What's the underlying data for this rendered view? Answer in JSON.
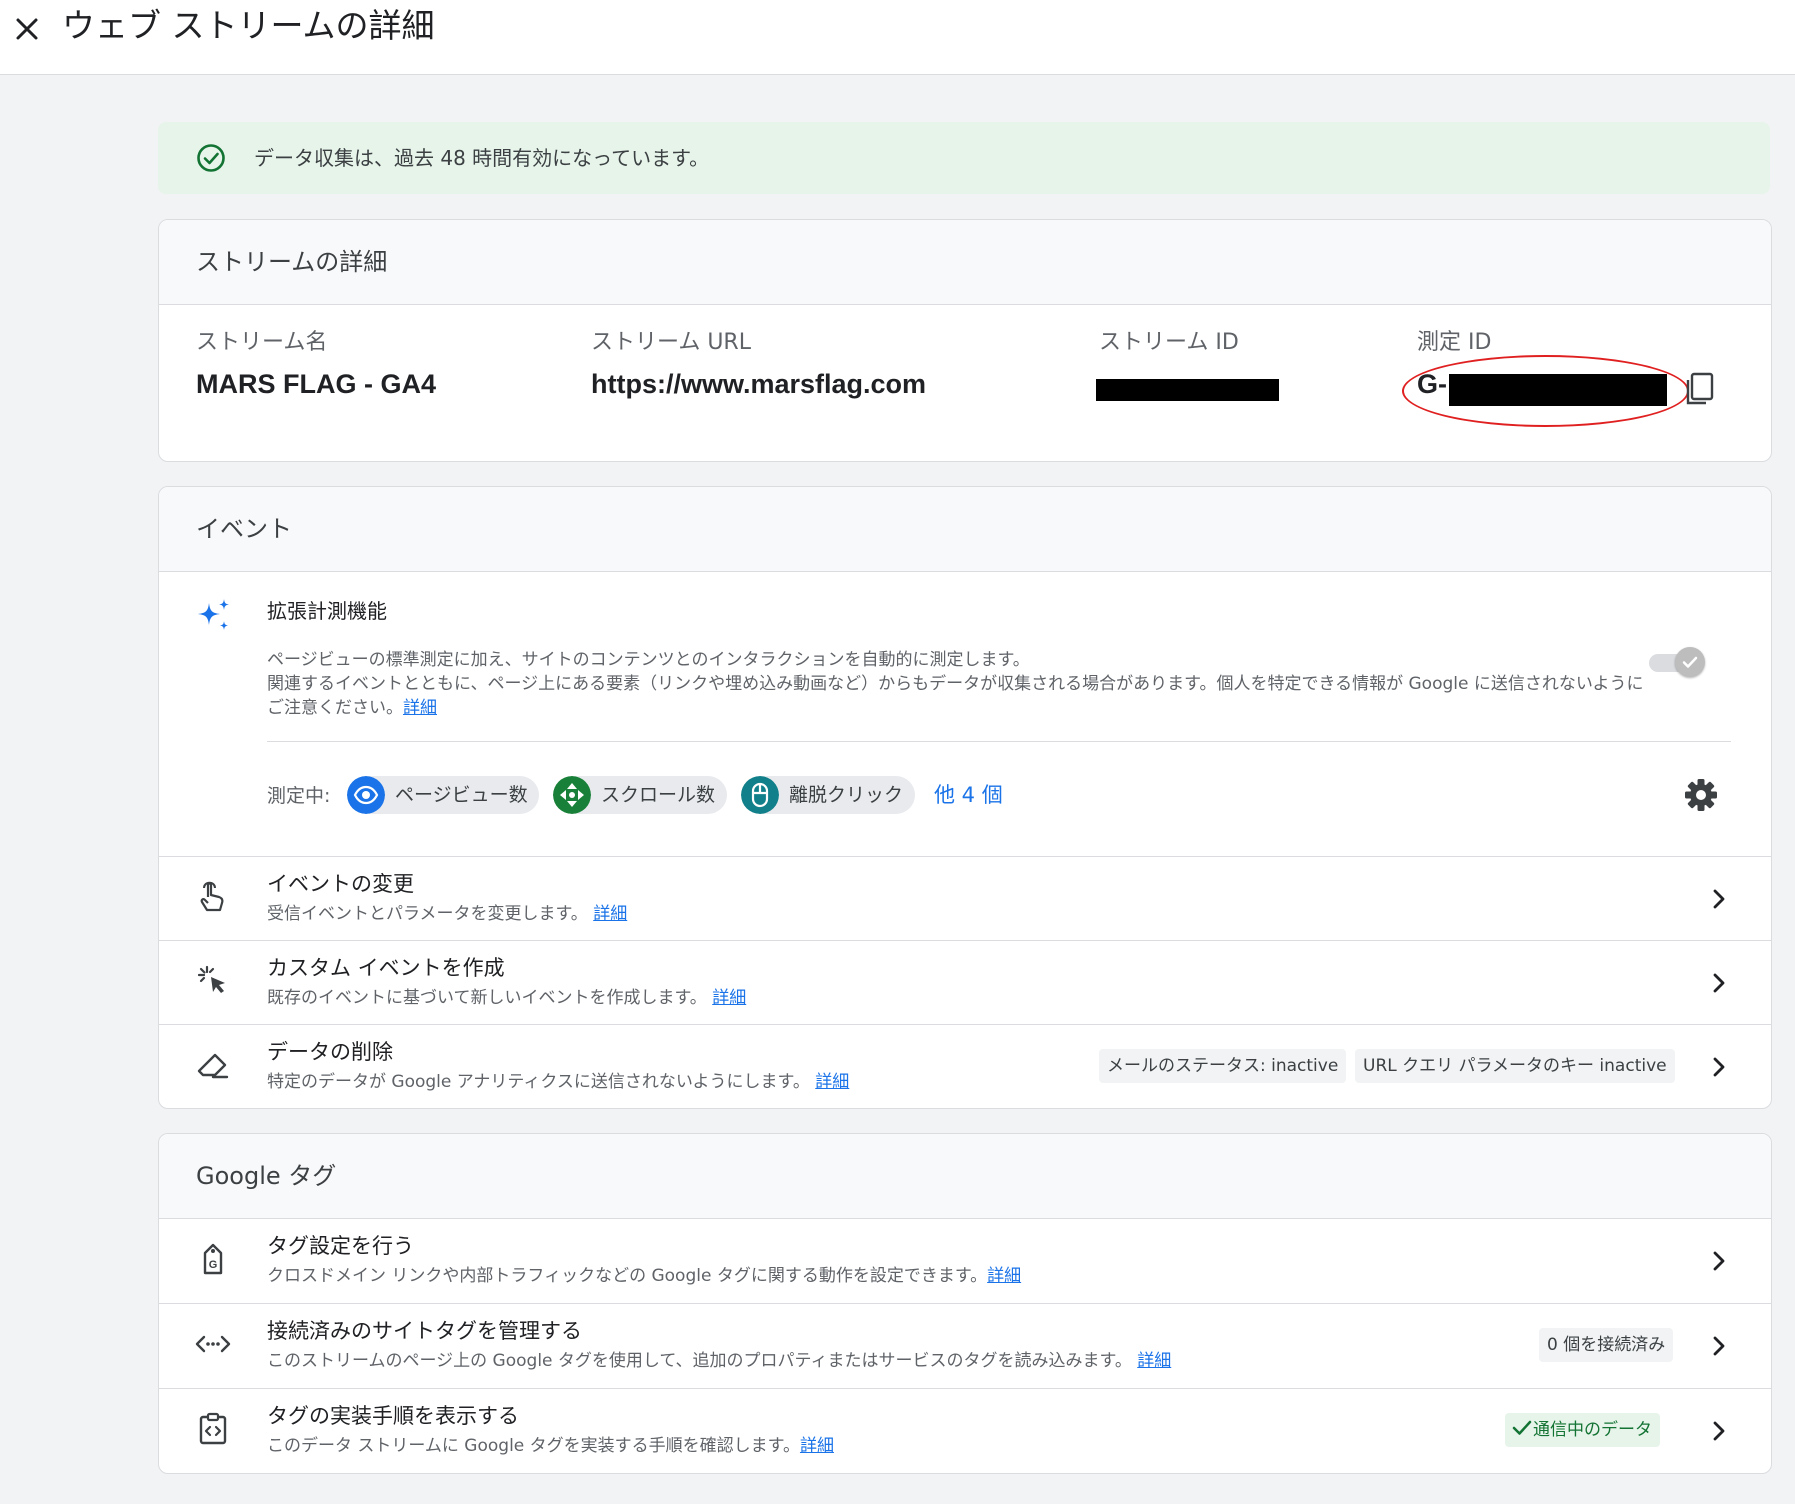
{
  "header": {
    "title": "ウェブ ストリームの詳細"
  },
  "banner": {
    "text": "データ収集は、過去 48 時間有効になっています。"
  },
  "stream_details": {
    "title": "ストリームの詳細",
    "fields": [
      {
        "label": "ストリーム名",
        "value": "MARS FLAG - GA4"
      },
      {
        "label": "ストリーム URL",
        "value": "https://www.marsflag.com"
      },
      {
        "label": "ストリーム ID",
        "value": ""
      },
      {
        "label": "測定 ID",
        "value": "G-"
      }
    ]
  },
  "events": {
    "title": "イベント",
    "enhanced": {
      "title": "拡張計測機能",
      "desc_line1": "ページビューの標準測定に加え、サイトのコンテンツとのインタラクションを自動的に測定します。",
      "desc_line2": "関連するイベントとともに、ページ上にある要素（リンクや埋め込み動画など）からもデータが収集される場合があります。個人を特定できる情報が Google に送信されないようにご注意ください。",
      "link": "詳細",
      "measuring_label": "測定中:",
      "chips": [
        "ページビュー数",
        "スクロール数",
        "離脱クリック"
      ],
      "more": "他 4 個",
      "toggle_on": true
    },
    "rows": [
      {
        "title": "イベントの変更",
        "sub": "受信イベントとパラメータを変更します。",
        "link": "詳細"
      },
      {
        "title": "カスタム イベントを作成",
        "sub": "既存のイベントに基づいて新しいイベントを作成します。",
        "link": "詳細"
      },
      {
        "title": "データの削除",
        "sub": "特定のデータが Google アナリティクスに送信されないようにします。",
        "link": "詳細",
        "pills": [
          "メールのステータス: inactive",
          "URL クエリ パラメータのキー inactive"
        ]
      }
    ]
  },
  "google_tag": {
    "title": "Google タグ",
    "rows": [
      {
        "title": "タグ設定を行う",
        "sub": "クロスドメイン リンクや内部トラフィックなどの Google タグに関する動作を設定できます。",
        "link": "詳細"
      },
      {
        "title": "接続済みのサイトタグを管理する",
        "sub": "このストリームのページ上の Google タグを使用して、追加のプロパティまたはサービスのタグを読み込みます。",
        "link": "詳細",
        "badge": "0 個を接続済み"
      },
      {
        "title": "タグの実装手順を表示する",
        "sub": "このデータ ストリームに Google タグを実装する手順を確認します。",
        "link": "詳細",
        "badge": "通信中のデータ"
      }
    ]
  },
  "colors": {
    "link": "#1a73e8",
    "success": "#137333",
    "success_bg": "#e6f4ea",
    "highlight": "#e02020"
  }
}
